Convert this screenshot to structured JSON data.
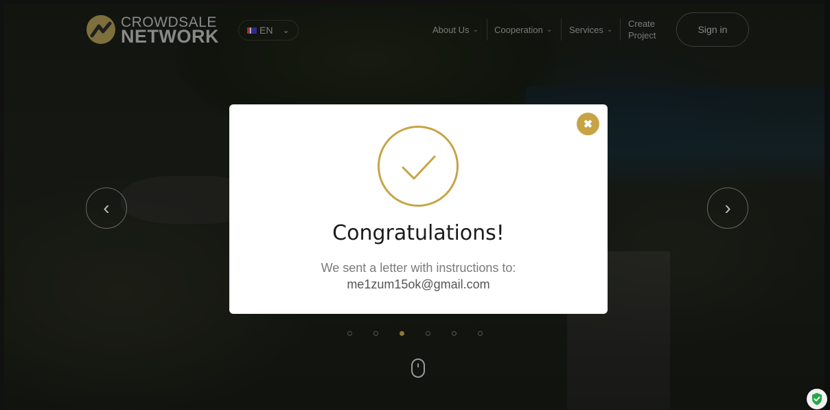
{
  "header": {
    "logo_line1": "CROWDSALE",
    "logo_line2": "NETWORK",
    "language": "EN",
    "nav": [
      {
        "label": "About Us"
      },
      {
        "label": "Cooperation"
      },
      {
        "label": "Services"
      }
    ],
    "create_project_line1": "Create",
    "create_project_line2": "Project",
    "signin_label": "Sign in"
  },
  "slider": {
    "prev_glyph": "‹",
    "next_glyph": "›",
    "dot_count": 6,
    "active_dot": 3
  },
  "modal": {
    "close_glyph": "✖",
    "title": "Congratulations!",
    "message": "We sent a letter with instructions to:",
    "email": "me1zum15ok@gmail.com"
  },
  "colors": {
    "accent_gold": "#c6a446",
    "modal_bg": "#ffffff",
    "shield_green": "#27a745"
  }
}
